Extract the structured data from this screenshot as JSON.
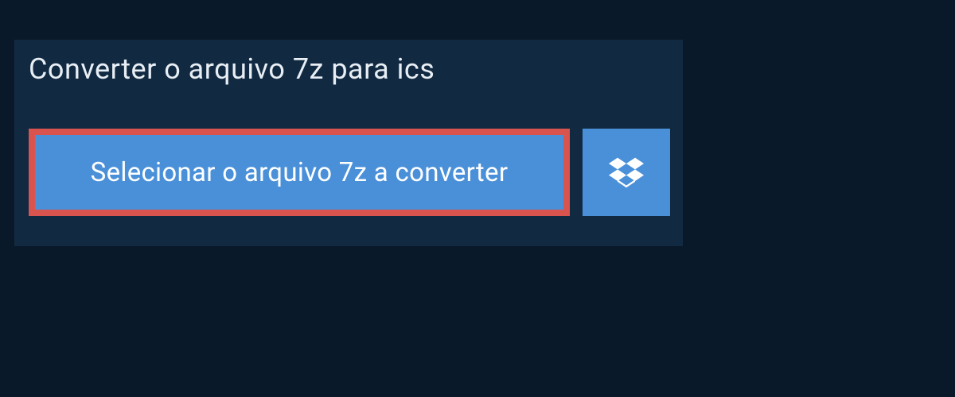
{
  "panel": {
    "title": "Converter o arquivo 7z para ics",
    "select_button_label": "Selecionar o arquivo 7z a converter"
  }
}
